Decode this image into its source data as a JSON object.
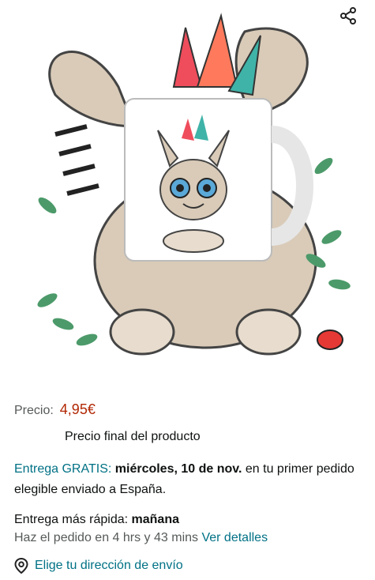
{
  "product": {
    "image_alt": "Taza blanca con conejo ilustrado con plumas",
    "share_icon": "share-icon"
  },
  "price": {
    "label": "Precio:",
    "value": "4,95€",
    "final_note": "Precio final del producto"
  },
  "delivery": {
    "link_text": "Entrega GRATIS:",
    "date": "miércoles, 10 de nov.",
    "rest": " en tu primer pedido elegible enviado a España."
  },
  "fastest": {
    "label": "Entrega más rápida:",
    "date": "mañana",
    "order_within": "Haz el pedido en 4 hrs y 43 mins",
    "details_link": "Ver detalles"
  },
  "address": {
    "icon": "location-pin-icon",
    "label": "Elige tu dirección de envío"
  },
  "colors": {
    "price": "#b12704",
    "link": "#007185",
    "secondary": "#565959"
  }
}
